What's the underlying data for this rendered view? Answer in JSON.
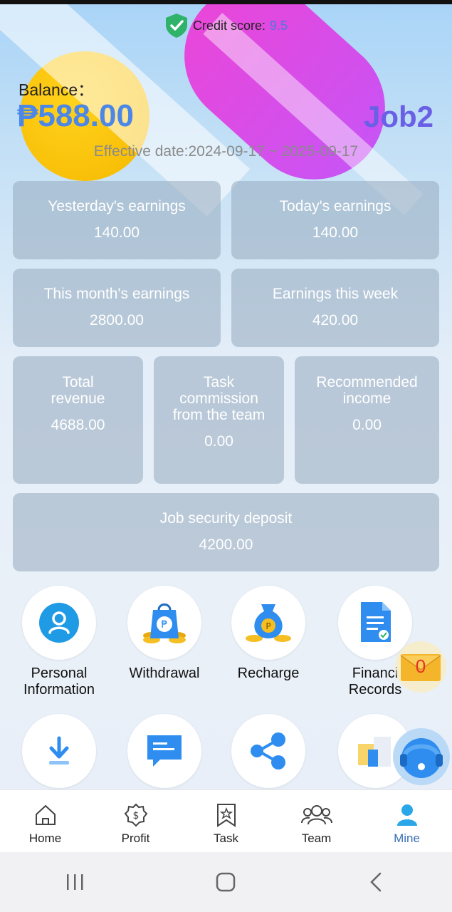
{
  "header": {
    "credit_label": "Credit score:",
    "credit_value": "9.5",
    "balance_label": "Balance：",
    "balance_amount": "₱588.00",
    "job_name": "Job2",
    "effective_date": "Effective date:2024-09-17 ~ 2025-09-17"
  },
  "stats": {
    "yesterday": {
      "label": "Yesterday's earnings",
      "value": "140.00"
    },
    "today": {
      "label": "Today's earnings",
      "value": "140.00"
    },
    "month": {
      "label": "This month's earnings",
      "value": "2800.00"
    },
    "week": {
      "label": "Earnings this week",
      "value": "420.00"
    },
    "total": {
      "label": "Total revenue",
      "value": "4688.00"
    },
    "team_commission": {
      "label": "Task commission from the team",
      "value": "0.00"
    },
    "recommended": {
      "label": "Recommended income",
      "value": "0.00"
    },
    "deposit": {
      "label": "Job security deposit",
      "value": "4200.00"
    }
  },
  "menu": {
    "personal": "Personal Information",
    "withdrawal": "Withdrawal",
    "recharge": "Recharge",
    "financial": "Financi\nRecords"
  },
  "mail_count": "0",
  "tabs": [
    {
      "label": "Home",
      "icon": "home-icon"
    },
    {
      "label": "Profit",
      "icon": "profit-icon"
    },
    {
      "label": "Task",
      "icon": "task-icon"
    },
    {
      "label": "Team",
      "icon": "team-icon"
    },
    {
      "label": "Mine",
      "icon": "mine-icon"
    }
  ],
  "colors": {
    "accent": "#4b86e9",
    "job": "#6a60e6",
    "active_tab": "#3a6fb6"
  }
}
